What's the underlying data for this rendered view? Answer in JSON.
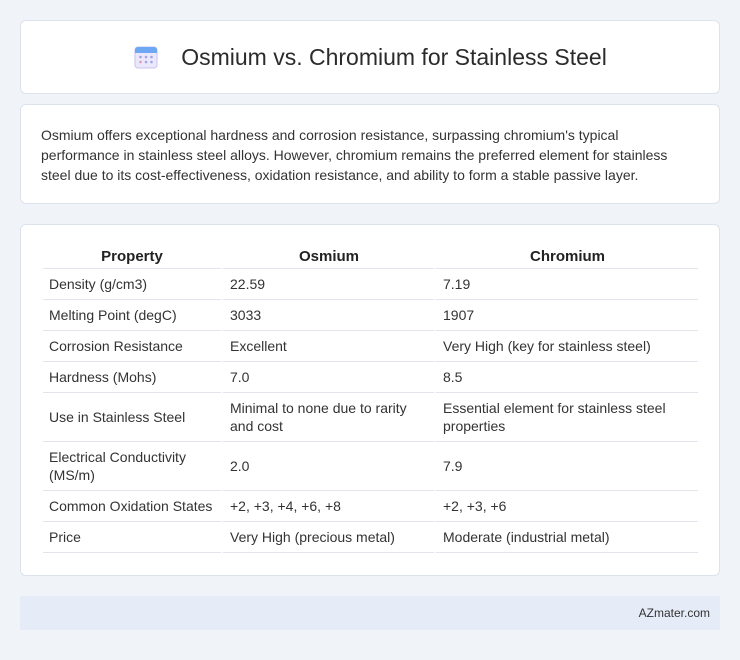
{
  "header": {
    "icon": "calendar-icon",
    "title": "Osmium vs. Chromium for Stainless Steel"
  },
  "intro": {
    "text": "Osmium offers exceptional hardness and corrosion resistance, surpassing chromium's typical performance in stainless steel alloys. However, chromium remains the preferred element for stainless steel due to its cost-effectiveness, oxidation resistance, and ability to form a stable passive layer."
  },
  "table": {
    "headers": [
      "Property",
      "Osmium",
      "Chromium"
    ],
    "rows": [
      [
        "Density (g/cm3)",
        "22.59",
        "7.19"
      ],
      [
        "Melting Point (degC)",
        "3033",
        "1907"
      ],
      [
        "Corrosion Resistance",
        "Excellent",
        "Very High (key for stainless steel)"
      ],
      [
        "Hardness (Mohs)",
        "7.0",
        "8.5"
      ],
      [
        "Use in Stainless Steel",
        "Minimal to none due to rarity and cost",
        "Essential element for stainless steel properties"
      ],
      [
        "Electrical Conductivity (MS/m)",
        "2.0",
        "7.9"
      ],
      [
        "Common Oxidation States",
        "+2, +3, +4, +6, +8",
        "+2, +3, +6"
      ],
      [
        "Price",
        "Very High (precious metal)",
        "Moderate (industrial metal)"
      ]
    ]
  },
  "footer": {
    "brand": "AZmater.com"
  }
}
